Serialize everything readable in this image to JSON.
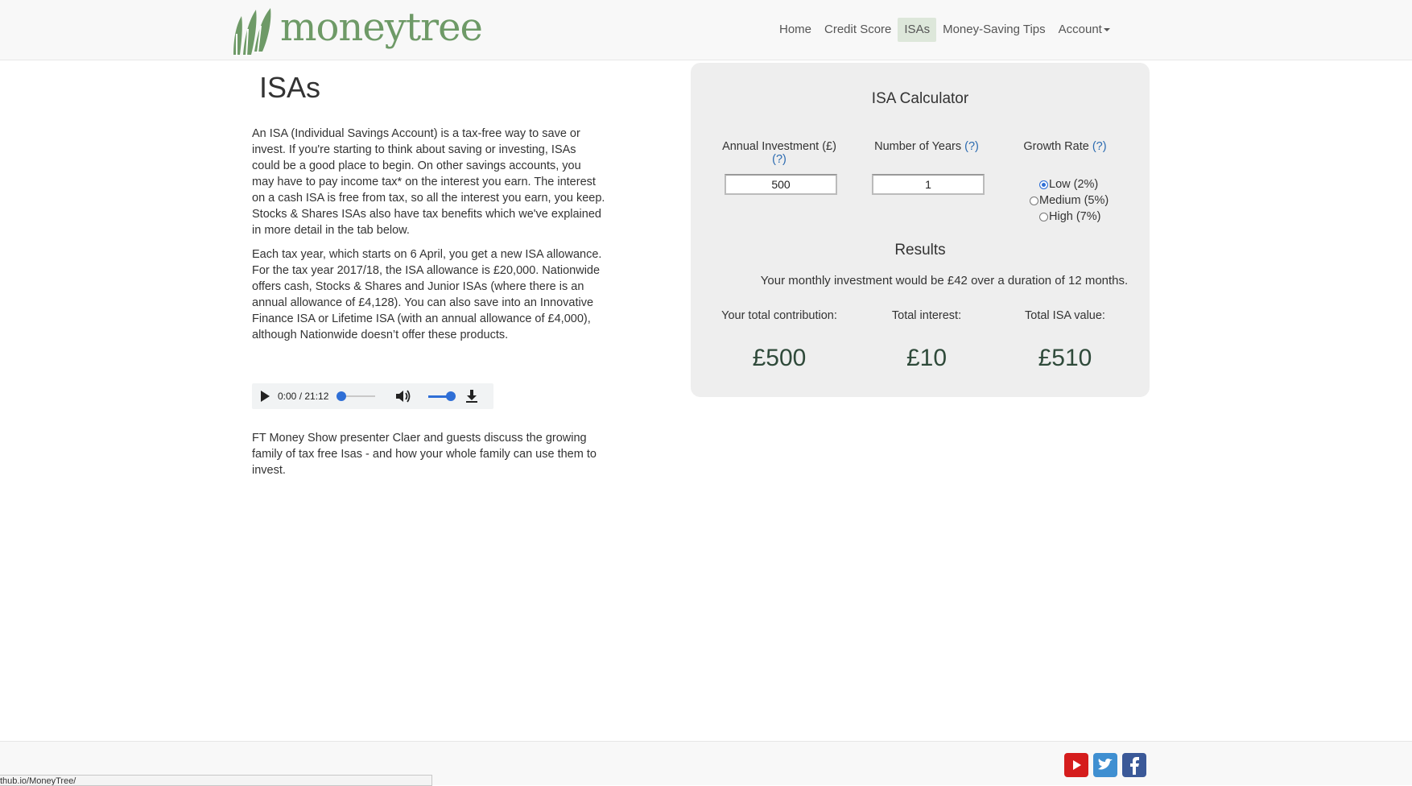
{
  "brand": {
    "name": "moneytree"
  },
  "nav": {
    "items": [
      {
        "label": "Home"
      },
      {
        "label": "Credit Score"
      },
      {
        "label": "ISAs"
      },
      {
        "label": "Money-Saving Tips"
      },
      {
        "label": "Account"
      }
    ],
    "active": "ISAs"
  },
  "page": {
    "title": "ISAs",
    "paragraph1": "An ISA (Individual Savings Account) is a tax-free way to save or invest. If you're starting to think about saving or investing, ISAs could be a good place to begin. On other savings accounts, you may have to pay income tax* on the interest you earn. The interest on a cash ISA is free from tax, so all the interest you earn, you keep. Stocks & Shares ISAs also have tax benefits which we've explained in more detail in the tab below.",
    "paragraph2": "Each tax year, which starts on 6 April, you get a new ISA allowance. For the tax year 2017/18, the ISA allowance is £20,000. Nationwide offers cash, Stocks & Shares and Junior ISAs (where there is an annual allowance of £4,128). You can also save into an Innovative Finance ISA or Lifetime ISA (with an annual allowance of £4,000), although Nationwide doesn’t offer these products.",
    "audio_caption": "FT Money Show presenter Claer and guests discuss the growing family of tax free Isas - and how your whole family can use them to invest."
  },
  "audio": {
    "time": "0:00 / 21:12",
    "progress_fraction": 0.0,
    "volume_fraction": 1.0
  },
  "calculator": {
    "title": "ISA Calculator",
    "help_link": "(?)",
    "annual_investment": {
      "label": "Annual Investment (£)",
      "value": "500"
    },
    "years": {
      "label": "Number of Years",
      "value": "1"
    },
    "growth_rate": {
      "label": "Growth Rate",
      "options": [
        {
          "label": "Low (2%)",
          "checked": true
        },
        {
          "label": "Medium (5%)",
          "checked": false
        },
        {
          "label": "High (7%)",
          "checked": false
        }
      ]
    },
    "results_title": "Results",
    "summary": {
      "prefix": "Your monthly investment would be ",
      "monthly": "£42",
      "middle": " over a duration of ",
      "duration": "12 months",
      "suffix": "."
    },
    "results": [
      {
        "label": "Your total contribution:",
        "value": "£500"
      },
      {
        "label": "Total interest:",
        "value": "£10"
      },
      {
        "label": "Total ISA value:",
        "value": "£510"
      }
    ]
  },
  "footer": {
    "social": [
      "youtube-icon",
      "twitter-icon",
      "facebook-icon"
    ],
    "status_url": "thub.io/MoneyTree/"
  },
  "colors": {
    "brand_green": "#6e9a67",
    "nav_active_bg": "#dde7da",
    "panel_bg": "#eeeeee",
    "help_blue": "#2a6ab0"
  }
}
